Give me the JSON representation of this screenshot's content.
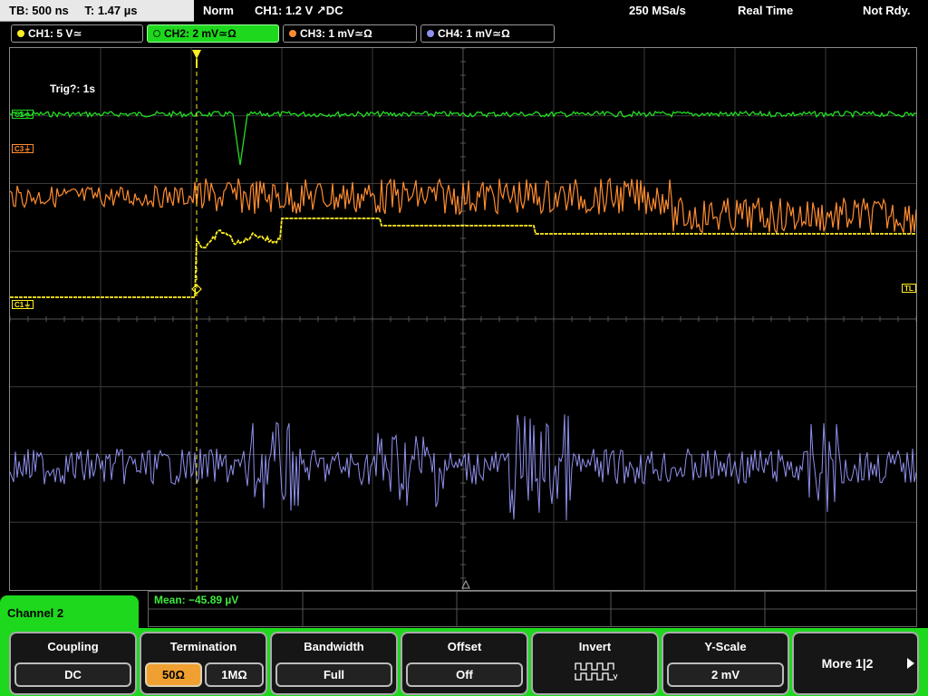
{
  "topbar": {
    "timebase": "TB: 500 ns",
    "trigger_time": "T: 1.47 µs",
    "trigger_mode": "Norm",
    "trigger_info": "CH1: 1.2 V ↗DC",
    "sample_rate": "250 MSa/s",
    "acq_mode": "Real Time",
    "status": "Not Rdy."
  },
  "channels": [
    {
      "label": "CH1: 5 V≃",
      "color": "#ffee22"
    },
    {
      "label": "CH2: 2 mV≃Ω",
      "color": "#22dd22"
    },
    {
      "label": "CH3: 1 mV≃Ω",
      "color": "#ff8c30"
    },
    {
      "label": "CH4: 1 mV≃Ω",
      "color": "#9090ee"
    }
  ],
  "screen": {
    "trig_text": "Trig?: 1s",
    "marker_c1": "C1⏚",
    "marker_c2": "C2⏚",
    "marker_c3": "C3⏚",
    "marker_tl": "TL"
  },
  "measurement": {
    "mean": "Mean: −45.89 µV"
  },
  "menu": {
    "title": "Channel 2",
    "coupling": {
      "title": "Coupling",
      "value": "DC"
    },
    "termination": {
      "title": "Termination",
      "opt1": "50Ω",
      "opt2": "1MΩ"
    },
    "bandwidth": {
      "title": "Bandwidth",
      "value": "Full"
    },
    "offset": {
      "title": "Offset",
      "value": "Off"
    },
    "invert": {
      "title": "Invert"
    },
    "yscale": {
      "title": "Y-Scale",
      "value": "2 mV"
    },
    "more": {
      "label": "More 1|2"
    }
  }
}
